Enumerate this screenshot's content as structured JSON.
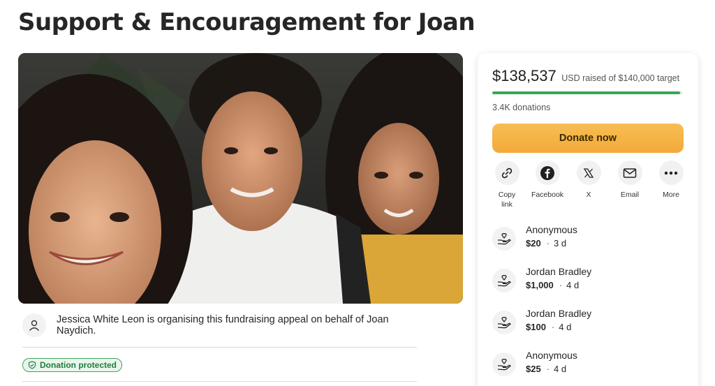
{
  "page": {
    "title": "Support & Encouragement for Joan"
  },
  "organiser": {
    "text": "Jessica White Leon is organising this fundraising appeal on behalf of Joan Naydich."
  },
  "badge": {
    "label": "Donation protected"
  },
  "progress": {
    "raised": "$138,537",
    "target_text": "USD raised of $140,000 target",
    "fraction": 0.9895,
    "donations": "3.4K donations"
  },
  "donate": {
    "label": "Donate now"
  },
  "share": [
    {
      "icon": "link-icon",
      "label": "Copy link"
    },
    {
      "icon": "facebook-icon",
      "label": "Facebook"
    },
    {
      "icon": "x-icon",
      "label": "X"
    },
    {
      "icon": "email-icon",
      "label": "Email"
    },
    {
      "icon": "more-icon",
      "label": "More"
    }
  ],
  "donors": [
    {
      "name": "Anonymous",
      "amount": "$20",
      "time": "3 d"
    },
    {
      "name": "Jordan Bradley",
      "amount": "$1,000",
      "time": "4 d"
    },
    {
      "name": "Jordan Bradley",
      "amount": "$100",
      "time": "4 d"
    },
    {
      "name": "Anonymous",
      "amount": "$25",
      "time": "4 d"
    }
  ],
  "colors": {
    "donate_button": "#f3a93a",
    "progress": "#34a853",
    "protected_badge": "#1e7e3c"
  }
}
